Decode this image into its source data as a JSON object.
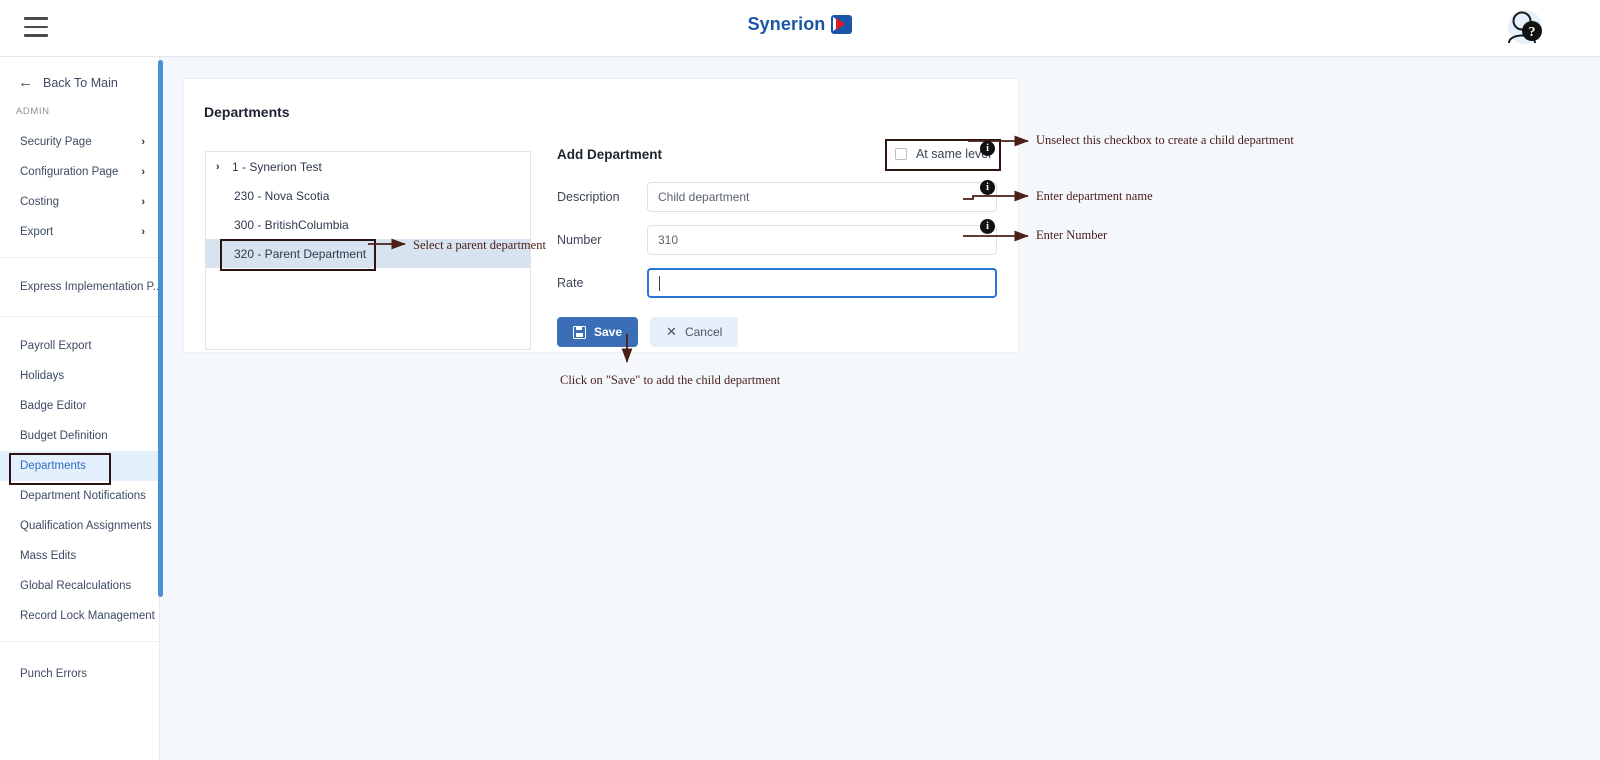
{
  "topbar": {
    "menu_icon": "hamburger-icon",
    "brand_name": "Synerion",
    "help_icon": "help-question-icon"
  },
  "sidebar": {
    "back_label": "Back To Main",
    "back_icon": "arrow-left-icon",
    "section_label": "ADMIN",
    "expandable_items": [
      {
        "label": "Security Page",
        "chevron": "›"
      },
      {
        "label": "Configuration Page",
        "chevron": "›"
      },
      {
        "label": "Costing",
        "chevron": "›"
      },
      {
        "label": "Export",
        "chevron": "›"
      }
    ],
    "group_express": [
      {
        "label": "Express Implementation P..."
      }
    ],
    "group_main": [
      {
        "label": "Payroll Export",
        "active": false
      },
      {
        "label": "Holidays",
        "active": false
      },
      {
        "label": "Badge Editor",
        "active": false
      },
      {
        "label": "Budget Definition",
        "active": false
      },
      {
        "label": "Departments",
        "active": true
      },
      {
        "label": "Department Notifications",
        "active": false
      },
      {
        "label": "Qualification Assignments",
        "active": false
      },
      {
        "label": "Mass Edits",
        "active": false
      },
      {
        "label": "Global Recalculations",
        "active": false
      },
      {
        "label": "Record Lock Management",
        "active": false
      }
    ],
    "group_bottom": [
      {
        "label": "Punch Errors"
      }
    ],
    "scrollbar_color": "#4a90d9"
  },
  "page": {
    "title": "Departments"
  },
  "tree": {
    "rows": [
      {
        "label": "1 - Synerion Test",
        "twisty": "›",
        "selected": false
      },
      {
        "label": "230 - Nova Scotia",
        "twisty": "",
        "selected": false
      },
      {
        "label": "300 - BritishColumbia",
        "twisty": "",
        "selected": false
      },
      {
        "label": "320 - Parent Department",
        "twisty": "",
        "selected": true
      }
    ]
  },
  "form": {
    "title": "Add Department",
    "same_level_label": "At same level",
    "same_level_checked": false,
    "description_label": "Description",
    "description_value": "Child department",
    "number_label": "Number",
    "number_value": "310",
    "rate_label": "Rate",
    "rate_value": "",
    "save_label": "Save",
    "cancel_label": "Cancel",
    "save_icon": "floppy-disk-icon",
    "cancel_icon": "close-x-icon"
  },
  "annotations": {
    "checkbox_note": "Unselect this checkbox to create a child department",
    "description_note": "Enter department name",
    "number_note": "Enter Number",
    "tree_note": "Select a parent department",
    "save_note": "Click on \"Save\" to add the child department",
    "info_icon": "info-icon",
    "color": "#4a1f18"
  }
}
